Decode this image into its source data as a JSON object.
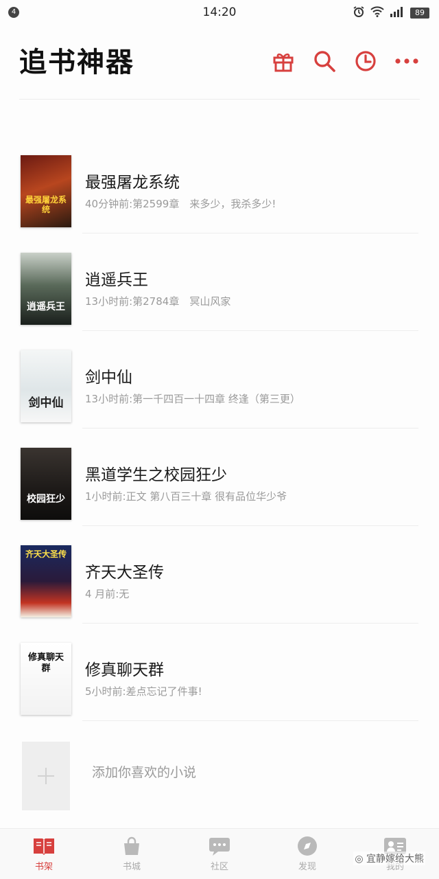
{
  "status_bar": {
    "notification_count": "4",
    "time": "14:20",
    "battery": "89"
  },
  "header": {
    "title": "追书神器",
    "accent_color": "#d7403e",
    "actions": [
      "gift-icon",
      "search-icon",
      "history-icon",
      "more-icon"
    ]
  },
  "books": [
    {
      "title": "最强屠龙系统",
      "subtitle": "40分钟前:第2599章　来多少，我杀多少!",
      "cover_text": "最强屠龙系统"
    },
    {
      "title": "逍遥兵王",
      "subtitle": "13小时前:第2784章　冥山风家",
      "cover_text": "逍遥兵王"
    },
    {
      "title": "剑中仙",
      "subtitle": "13小时前:第一千四百一十四章 终逢（第三更）",
      "cover_text": "剑中仙"
    },
    {
      "title": "黑道学生之校园狂少",
      "subtitle": "1小时前:正文 第八百三十章 很有品位华少爷",
      "cover_text": "校园狂少"
    },
    {
      "title": "齐天大圣传",
      "subtitle": "4 月前:无",
      "cover_text": "齐天大圣传"
    },
    {
      "title": "修真聊天群",
      "subtitle": "5小时前:差点忘记了件事!",
      "cover_text": "修真聊天群"
    }
  ],
  "add_book": {
    "label": "添加你喜欢的小说"
  },
  "tabs": [
    {
      "label": "书架",
      "icon": "bookshelf-icon",
      "active": true
    },
    {
      "label": "书城",
      "icon": "store-icon",
      "active": false
    },
    {
      "label": "社区",
      "icon": "community-icon",
      "active": false
    },
    {
      "label": "发现",
      "icon": "discover-icon",
      "active": false
    },
    {
      "label": "我的",
      "icon": "profile-icon",
      "active": false
    }
  ],
  "watermark": "宜静嫁给大熊"
}
